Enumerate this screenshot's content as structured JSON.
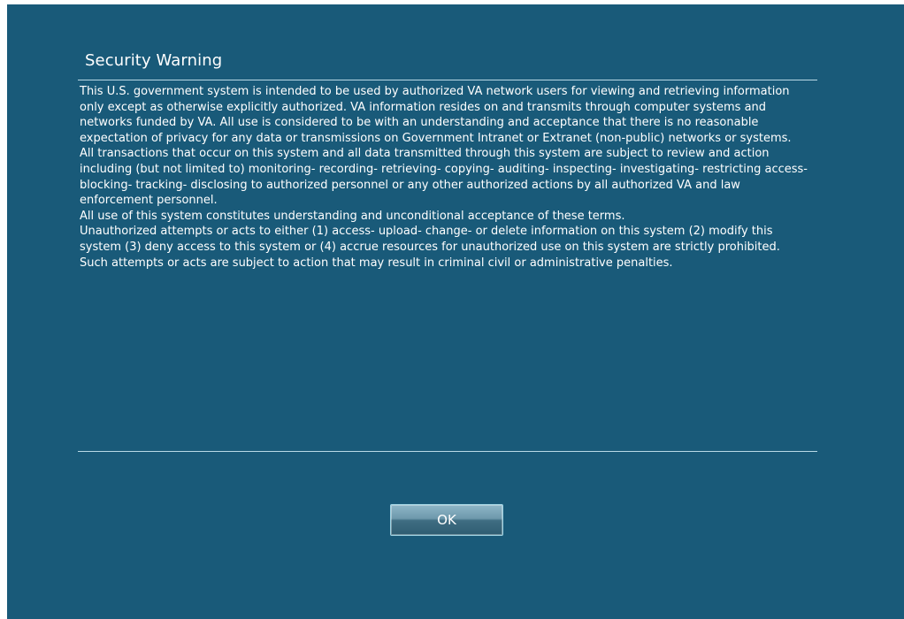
{
  "dialog": {
    "title": "Security Warning",
    "paragraphs": [
      "This U.S. government system is intended to be used by authorized VA network users for viewing and retrieving information only except as otherwise explicitly authorized. VA information resides on and transmits through computer systems and networks funded by VA. All use is considered to be with an understanding and acceptance that there is no reasonable expectation of privacy for any data or transmissions on Government Intranet or Extranet (non-public) networks or systems.",
      "All transactions that occur on this system and all data transmitted through this system are subject to review and action including (but not limited to) monitoring- recording- retrieving- copying- auditing- inspecting- investigating- restricting access- blocking- tracking- disclosing to authorized personnel or any other authorized actions by all authorized VA and law enforcement personnel.",
      "All use of this system constitutes understanding and unconditional acceptance of these terms.",
      "Unauthorized attempts or acts to either (1) access- upload- change- or delete information on this system (2) modify this system (3) deny access to this system or (4) accrue resources for unauthorized use on this system are strictly prohibited.",
      "Such attempts or acts are subject to action that may result in criminal civil or administrative penalties."
    ],
    "ok_label": "OK"
  },
  "colors": {
    "background": "#195a79",
    "rule": "#b9d9e6",
    "text": "#ffffff"
  }
}
